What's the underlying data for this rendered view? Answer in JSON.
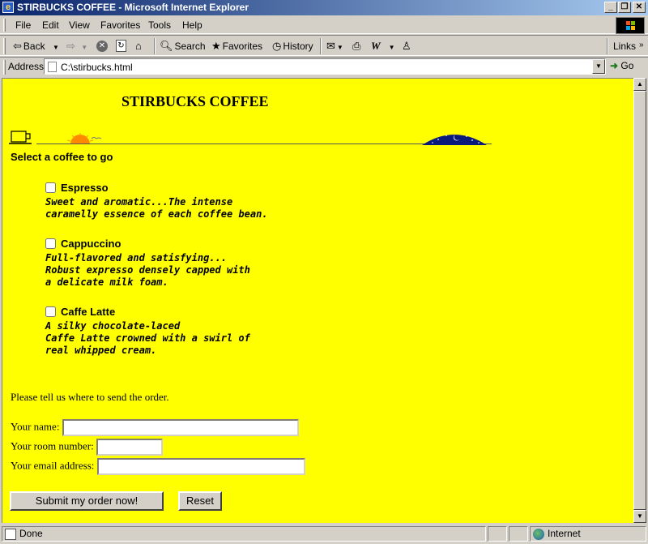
{
  "window": {
    "title": "STIRBUCKS COFFEE - Microsoft Internet Explorer",
    "minimize": "_",
    "restore": "❐",
    "close": "✕"
  },
  "menu": [
    "File",
    "Edit",
    "View",
    "Favorites",
    "Tools",
    "Help"
  ],
  "toolbar": {
    "back": "Back",
    "forward": "",
    "search": "Search",
    "favorites": "Favorites",
    "history": "History",
    "links": "Links"
  },
  "address": {
    "label": "Address",
    "url": "C:\\stirbucks.html",
    "go": "Go"
  },
  "page": {
    "title": "STIRBUCKS COFFEE",
    "prompt": "Select a coffee to go",
    "coffees": [
      {
        "name": "Espresso",
        "checked": false,
        "description": "Sweet and aromatic...The intense\ncaramelly essence of each coffee bean."
      },
      {
        "name": "Cappuccino",
        "checked": false,
        "description": "Full-flavored and satisfying...\nRobust expresso densely capped with\na delicate milk foam."
      },
      {
        "name": "Caffe Latte",
        "checked": false,
        "description": "A silky chocolate-laced\nCaffe Latte crowned with a swirl of\nreal whipped cream."
      }
    ],
    "send_text": "Please tell us where to send the order.",
    "form": {
      "name_label": "Your name:",
      "name_value": "",
      "room_label": "Your room number:",
      "room_value": "",
      "email_label": "Your email address:",
      "email_value": ""
    },
    "submit_label": "Submit my order now!",
    "reset_label": "Reset",
    "background_color": "#ffff00"
  },
  "status": {
    "text": "Done",
    "zone": "Internet"
  }
}
